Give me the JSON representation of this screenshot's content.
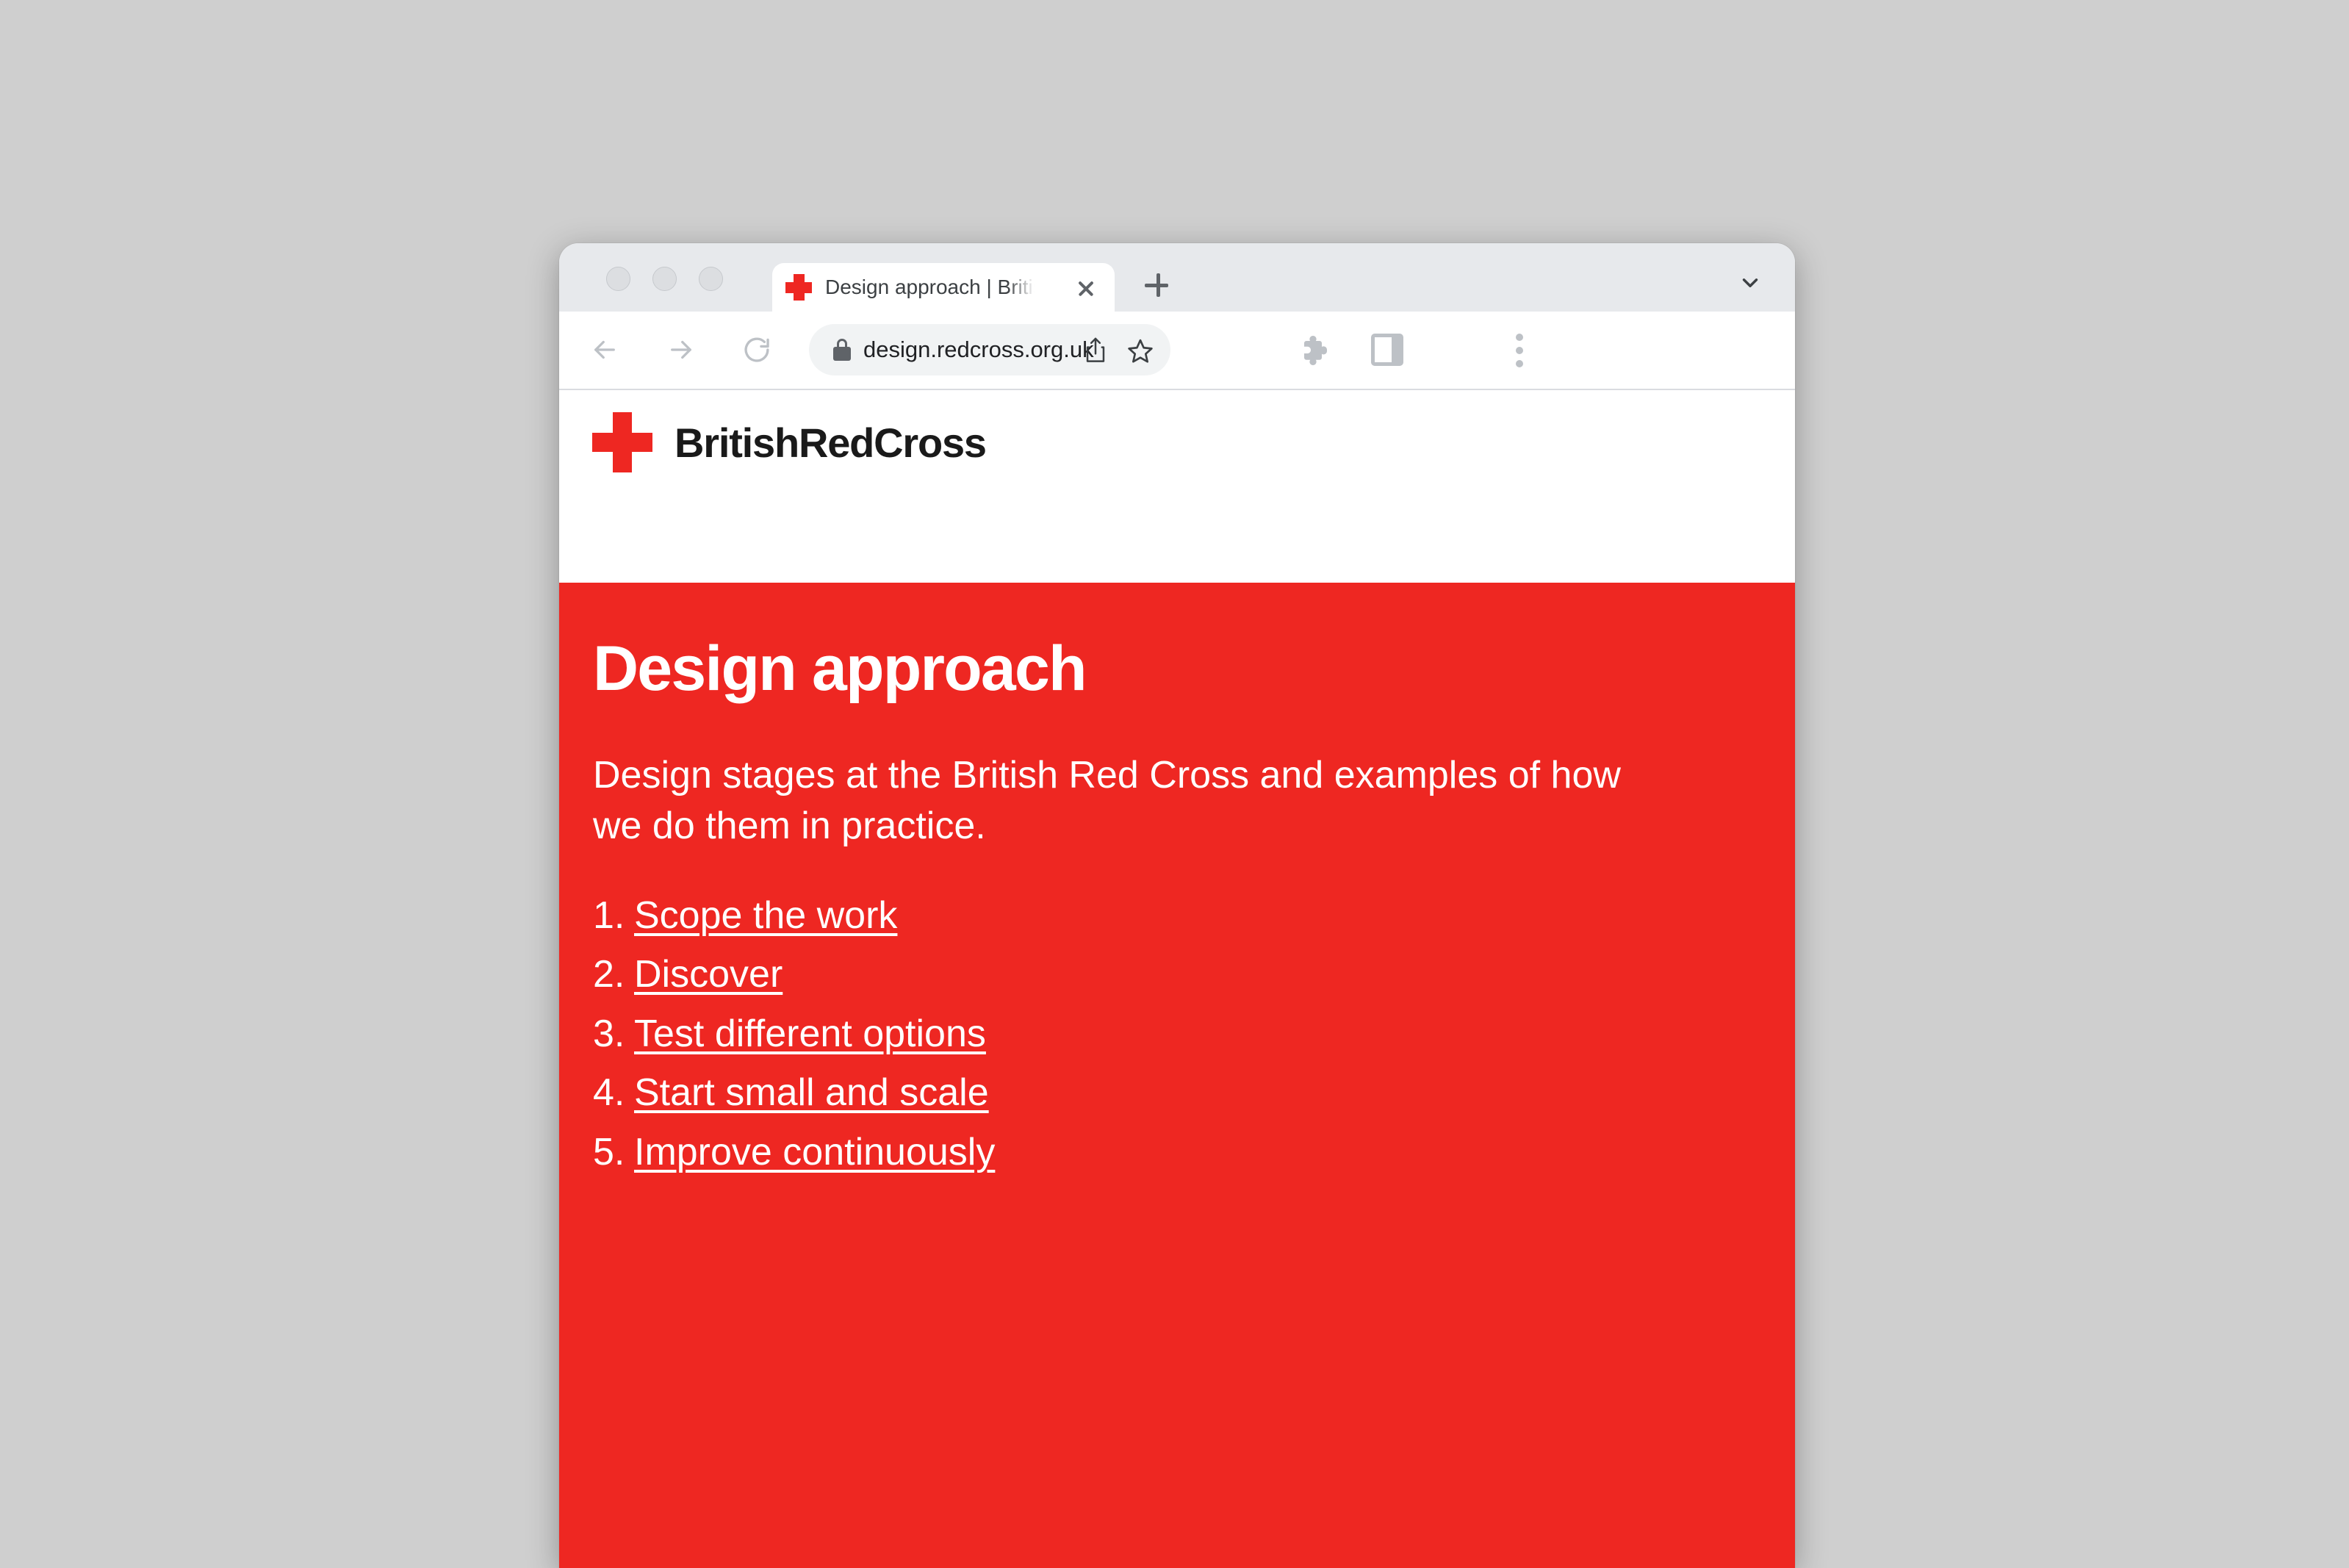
{
  "browser": {
    "traffic_lights": [
      "close",
      "minimize",
      "maximize"
    ],
    "tab": {
      "favicon": "red-cross-favicon",
      "title": "Design approach | British Red C",
      "close_label": "close-tab"
    },
    "new_tab_label": "+",
    "tab_list_icon": "chevron-down-icon",
    "nav": {
      "back_icon": "arrow-left-icon",
      "forward_icon": "arrow-right-icon",
      "reload_icon": "reload-icon"
    },
    "omnibox": {
      "security_icon": "lock-icon",
      "url": "design.redcross.org.uk",
      "share_icon": "share-icon",
      "bookmark_icon": "star-icon"
    },
    "toolbar_icons": {
      "extensions": "puzzle-piece-icon",
      "side_panel": "side-panel-icon",
      "menu": "three-dot-menu-icon"
    }
  },
  "site": {
    "logo_text": "BritishRedCross",
    "brand_red": "#EE2722"
  },
  "hero": {
    "title": "Design approach",
    "intro": "Design stages at the British Red Cross and examples of how we do them in practice.",
    "stages": [
      {
        "label": "Scope the work"
      },
      {
        "label": "Discover"
      },
      {
        "label": "Test different options"
      },
      {
        "label": "Start small and scale"
      },
      {
        "label": "Improve continuously"
      }
    ]
  }
}
